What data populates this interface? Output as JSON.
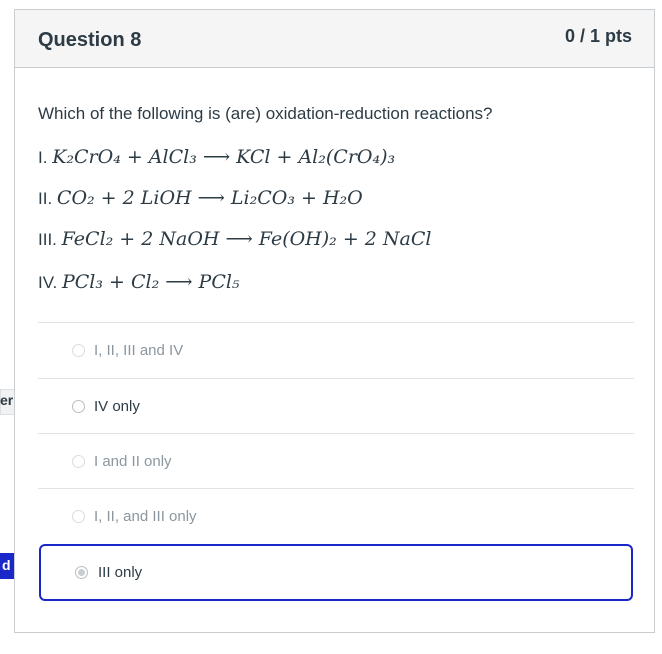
{
  "question": {
    "title": "Question 8",
    "points": "0 / 1 pts",
    "prompt": "Which of the following is (are) oxidation-reduction reactions?",
    "reactions": [
      {
        "label": "I.",
        "equation": "K₂CrO₄ + AlCl₃ ⟶ KCl + Al₂(CrO₄)₃"
      },
      {
        "label": "II.",
        "equation": "CO₂ + 2 LiOH ⟶ Li₂CO₃ + H₂O"
      },
      {
        "label": "III.",
        "equation": "FeCl₂ + 2 NaOH ⟶ Fe(OH)₂ + 2 NaCl"
      },
      {
        "label": "IV.",
        "equation": "PCl₃ + Cl₂ ⟶ PCl₅"
      }
    ]
  },
  "answers": [
    {
      "label": "I, II, III and IV"
    },
    {
      "label": "IV only"
    },
    {
      "label": "I and II only"
    },
    {
      "label": "I, II, and III only"
    },
    {
      "label": "III only"
    }
  ],
  "side_tags": {
    "correct_tag": "er",
    "answered_tag": "d"
  },
  "colors": {
    "selected_border": "#1a27c9",
    "correct_tag_fill": "#f2f2f2",
    "answered_tag_fill": "#1a27c9"
  }
}
